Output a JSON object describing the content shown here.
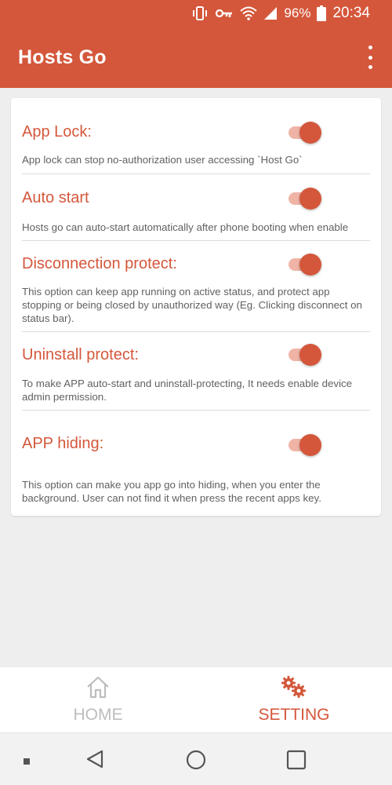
{
  "status_bar": {
    "battery_percent": "96%",
    "time": "20:34",
    "icons": [
      "vibrate-icon",
      "vpn-key-icon",
      "wifi-icon",
      "signal-icon",
      "battery-icon"
    ]
  },
  "app_bar": {
    "title": "Hosts Go",
    "menu_icon": "more-vertical-icon"
  },
  "settings": [
    {
      "title": "App Lock:",
      "description": "App lock can stop no-authorization user accessing `Host Go`",
      "enabled": true
    },
    {
      "title": "Auto start",
      "description": "Hosts go can auto-start automatically after phone booting when enable",
      "enabled": true
    },
    {
      "title": "Disconnection protect:",
      "description": "This option can keep app running on active status, and protect app stopping or being closed by unauthorized way (Eg. Clicking disconnect on status bar).",
      "enabled": true
    },
    {
      "title": "Uninstall protect:",
      "description": "To make APP auto-start and uninstall-protecting, It needs enable device admin permission.",
      "enabled": true
    },
    {
      "title": "APP hiding:",
      "description": "This option can make you app go into hiding, when you enter the background. User can not find it when press the recent apps key.",
      "enabled": true
    }
  ],
  "bottom_nav": {
    "home": {
      "label": "HOME",
      "icon": "home-icon",
      "selected": false
    },
    "setting": {
      "label": "SETTING",
      "icon": "gears-icon",
      "selected": true
    }
  },
  "system_nav": {
    "icons": [
      "recent-dot-icon",
      "back-icon",
      "home-circle-icon",
      "overview-square-icon"
    ]
  },
  "colors": {
    "accent": "#d4573b",
    "accent_light": "#f0b4a6",
    "background": "#eeeeee",
    "card": "#ffffff",
    "inactive": "#bdbdbd"
  }
}
